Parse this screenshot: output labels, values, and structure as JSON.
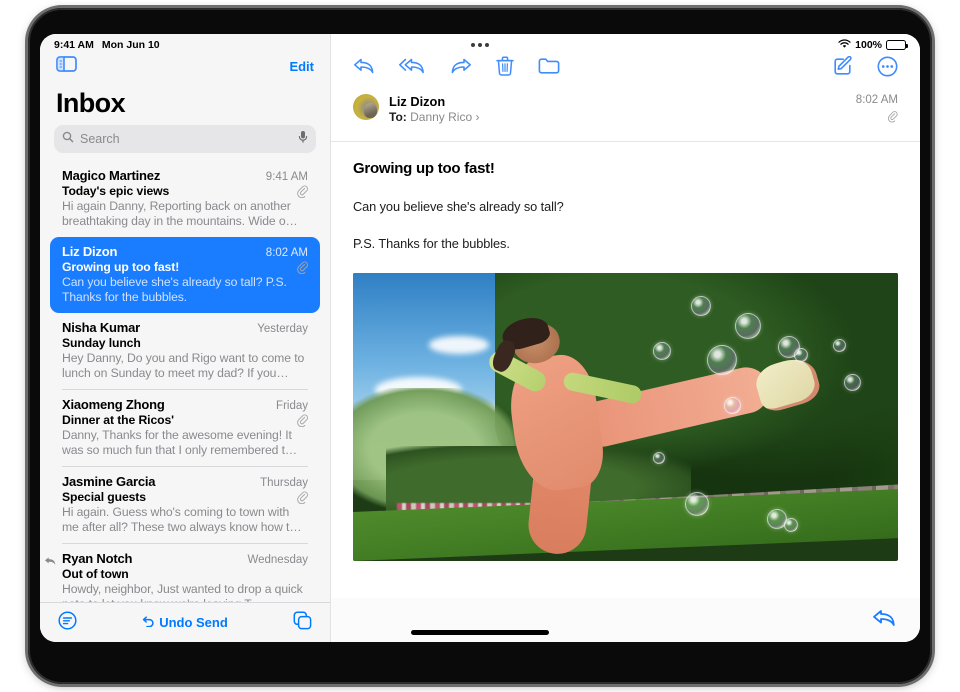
{
  "status_bar": {
    "time": "9:41 AM",
    "date": "Mon Jun 10",
    "battery_percent": "100%",
    "wifi_icon": "wifi-icon",
    "battery_icon": "battery-icon",
    "multitask_icon": "multitasking-dots-icon"
  },
  "sidebar": {
    "toggle_icon": "sidebar-toggle-icon",
    "edit_label": "Edit",
    "title": "Inbox",
    "search": {
      "placeholder": "Search",
      "search_icon": "search-icon",
      "dictation_icon": "microphone-icon"
    },
    "messages": [
      {
        "sender": "Magico Martinez",
        "date": "9:41 AM",
        "subject": "Today's epic views",
        "preview": "Hi again Danny, Reporting back on another breathtaking day in the mountains. Wide o…",
        "has_attachment": true,
        "replied": false,
        "selected": false
      },
      {
        "sender": "Liz Dizon",
        "date": "8:02 AM",
        "subject": "Growing up too fast!",
        "preview": "Can you believe she's already so tall? P.S. Thanks for the bubbles.",
        "has_attachment": true,
        "replied": false,
        "selected": true
      },
      {
        "sender": "Nisha Kumar",
        "date": "Yesterday",
        "subject": "Sunday lunch",
        "preview": "Hey Danny, Do you and Rigo want to come to lunch on Sunday to meet my dad? If you…",
        "has_attachment": false,
        "replied": false,
        "selected": false
      },
      {
        "sender": "Xiaomeng Zhong",
        "date": "Friday",
        "subject": "Dinner at the Ricos'",
        "preview": "Danny, Thanks for the awesome evening! It was so much fun that I only remembered t…",
        "has_attachment": true,
        "replied": false,
        "selected": false
      },
      {
        "sender": "Jasmine Garcia",
        "date": "Thursday",
        "subject": "Special guests",
        "preview": "Hi again. Guess who's coming to town with me after all? These two always know how t…",
        "has_attachment": true,
        "replied": false,
        "selected": false
      },
      {
        "sender": "Ryan Notch",
        "date": "Wednesday",
        "subject": "Out of town",
        "preview": "Howdy, neighbor, Just wanted to drop a quick note to let you know we're leaving T…",
        "has_attachment": false,
        "replied": true,
        "selected": false
      }
    ],
    "bottom_bar": {
      "filter_icon": "filter-lines-icon",
      "undo_send_label": "Undo Send",
      "undo_icon": "undo-arrow-icon",
      "new_window_icon": "duplicate-windows-icon"
    }
  },
  "detail": {
    "toolbar": {
      "reply_icon": "reply-arrow-icon",
      "reply_all_icon": "reply-all-arrow-icon",
      "forward_icon": "forward-arrow-icon",
      "delete_icon": "trash-icon",
      "move_icon": "folder-icon",
      "compose_icon": "compose-pencil-icon",
      "more_icon": "more-ellipsis-circle-icon"
    },
    "message": {
      "avatar": "sender-avatar",
      "from": "Liz Dizon",
      "to_label": "To:",
      "to_recipient": "Danny Rico",
      "disclosure": "›",
      "time": "8:02 AM",
      "attachment_icon": "paperclip-icon",
      "subject": "Growing up too fast!",
      "paragraphs": [
        "Can you believe she's already so tall?",
        "P.S. Thanks for the bubbles."
      ],
      "photo_alt": "photo-attachment"
    },
    "footer": {
      "reply_icon": "reply-arrow-icon"
    }
  },
  "colors": {
    "accent_blue": "#007aff",
    "selection_blue": "#1a7cff",
    "sidebar_bg": "#f6f6f7",
    "separator": "#d8d8dc",
    "secondary_text": "#8a8a8e"
  }
}
